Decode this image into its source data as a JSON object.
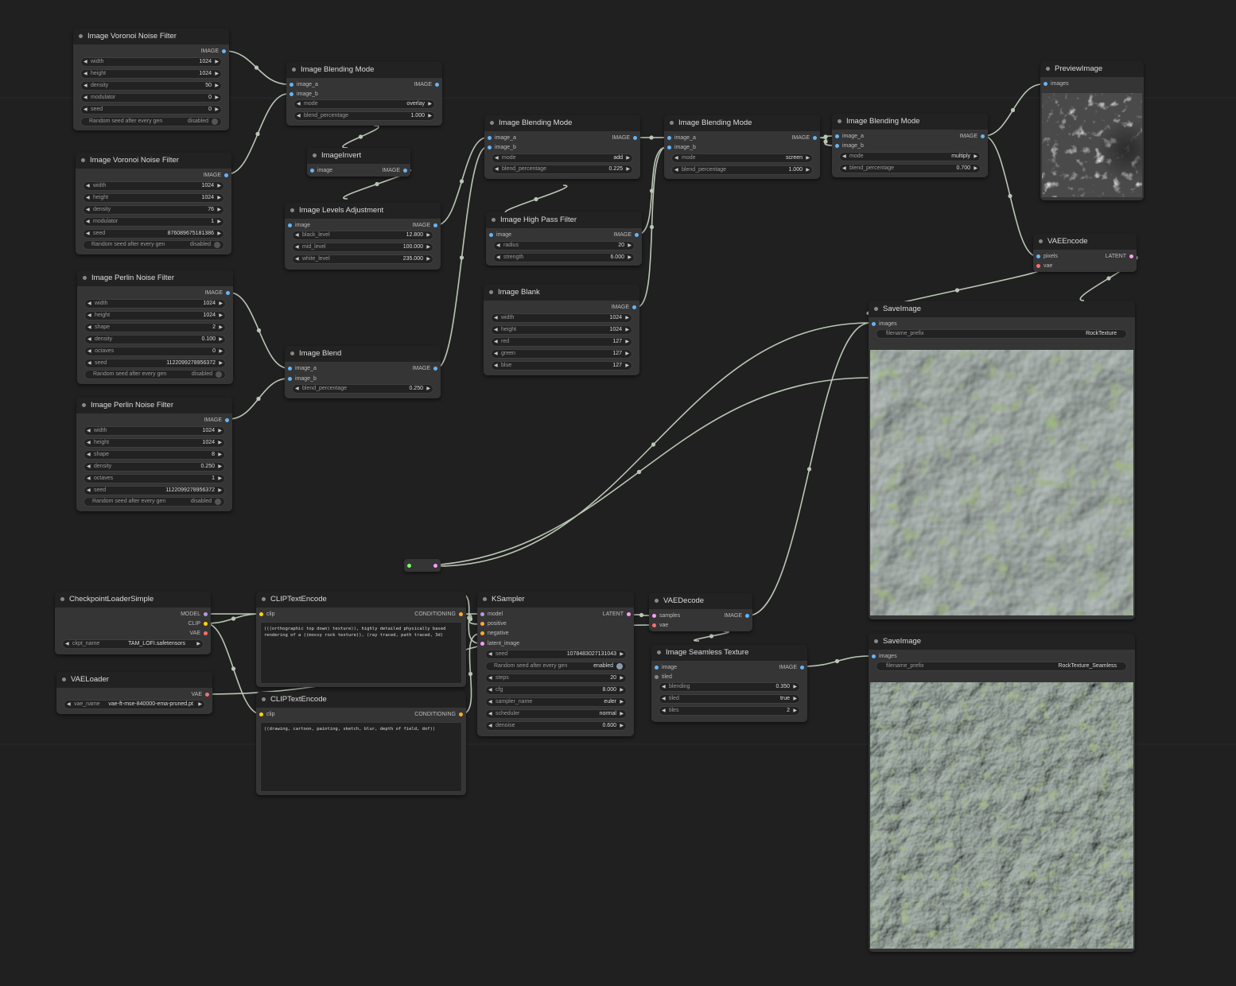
{
  "colors": {
    "canvas": "#202020",
    "node_body": "#353535",
    "node_title": "#222222",
    "wire": "#b9c7b4",
    "image_port": "#64b5f6",
    "latent_port": "#ff9cf9",
    "model_port": "#b39ddb",
    "clip_port": "#ffd500",
    "vae_port": "#ff6e6e",
    "conditioning_port": "#ffa931"
  },
  "nodes": {
    "voronoi1": {
      "title": "Image Voronoi Noise Filter",
      "out": "IMAGE",
      "widgets": [
        {
          "label": "width",
          "value": "1024"
        },
        {
          "label": "height",
          "value": "1024"
        },
        {
          "label": "density",
          "value": "50"
        },
        {
          "label": "modulator",
          "value": "0"
        },
        {
          "label": "seed",
          "value": "0"
        }
      ],
      "toggle": {
        "label": "Random seed after every gen",
        "value": "disabled"
      }
    },
    "voronoi2": {
      "title": "Image Voronoi Noise Filter",
      "out": "IMAGE",
      "widgets": [
        {
          "label": "width",
          "value": "1024"
        },
        {
          "label": "height",
          "value": "1024"
        },
        {
          "label": "density",
          "value": "76"
        },
        {
          "label": "modulator",
          "value": "1"
        },
        {
          "label": "seed",
          "value": "876089675181386"
        }
      ],
      "toggle": {
        "label": "Random seed after every gen",
        "value": "disabled"
      }
    },
    "perlin1": {
      "title": "Image Perlin Noise Filter",
      "out": "IMAGE",
      "widgets": [
        {
          "label": "width",
          "value": "1024"
        },
        {
          "label": "height",
          "value": "1024"
        },
        {
          "label": "shape",
          "value": "2"
        },
        {
          "label": "density",
          "value": "0.100"
        },
        {
          "label": "octaves",
          "value": "0"
        },
        {
          "label": "seed",
          "value": "1122099278956372"
        }
      ],
      "toggle": {
        "label": "Random seed after every gen",
        "value": "disabled"
      }
    },
    "perlin2": {
      "title": "Image Perlin Noise Filter",
      "out": "IMAGE",
      "widgets": [
        {
          "label": "width",
          "value": "1024"
        },
        {
          "label": "height",
          "value": "1024"
        },
        {
          "label": "shape",
          "value": "8"
        },
        {
          "label": "density",
          "value": "0.250"
        },
        {
          "label": "octaves",
          "value": "1"
        },
        {
          "label": "seed",
          "value": "1122099278956372"
        }
      ],
      "toggle": {
        "label": "Random seed after every gen",
        "value": "disabled"
      }
    },
    "blendmode1": {
      "title": "Image Blending Mode",
      "in_a": "image_a",
      "in_b": "image_b",
      "out": "IMAGE",
      "widgets": [
        {
          "label": "mode",
          "value": "overlay"
        },
        {
          "label": "blend_percentage",
          "value": "1.000"
        }
      ]
    },
    "invert": {
      "title": "ImageInvert",
      "in": "image",
      "out": "IMAGE"
    },
    "levels": {
      "title": "Image Levels Adjustment",
      "in": "image",
      "out": "IMAGE",
      "widgets": [
        {
          "label": "black_level",
          "value": "12.800"
        },
        {
          "label": "mid_level",
          "value": "100.000"
        },
        {
          "label": "white_level",
          "value": "235.000"
        }
      ]
    },
    "blend": {
      "title": "Image Blend",
      "in_a": "image_a",
      "in_b": "image_b",
      "out": "IMAGE",
      "widgets": [
        {
          "label": "blend_percentage",
          "value": "0.250"
        }
      ]
    },
    "blendmode2": {
      "title": "Image Blending Mode",
      "in_a": "image_a",
      "in_b": "image_b",
      "out": "IMAGE",
      "widgets": [
        {
          "label": "mode",
          "value": "add"
        },
        {
          "label": "blend_percentage",
          "value": "0.225"
        }
      ]
    },
    "highpass": {
      "title": "Image High Pass Filter",
      "in": "image",
      "out": "IMAGE",
      "widgets": [
        {
          "label": "radius",
          "value": "20"
        },
        {
          "label": "strength",
          "value": "6.000"
        }
      ]
    },
    "blank": {
      "title": "Image Blank",
      "out": "IMAGE",
      "widgets": [
        {
          "label": "width",
          "value": "1024"
        },
        {
          "label": "height",
          "value": "1024"
        },
        {
          "label": "red",
          "value": "127"
        },
        {
          "label": "green",
          "value": "127"
        },
        {
          "label": "blue",
          "value": "127"
        }
      ]
    },
    "blendmode3": {
      "title": "Image Blending Mode",
      "in_a": "image_a",
      "in_b": "image_b",
      "out": "IMAGE",
      "widgets": [
        {
          "label": "mode",
          "value": "screen"
        },
        {
          "label": "blend_percentage",
          "value": "1.000"
        }
      ]
    },
    "blendmode4": {
      "title": "Image Blending Mode",
      "in_a": "image_a",
      "in_b": "image_b",
      "out": "IMAGE",
      "widgets": [
        {
          "label": "mode",
          "value": "multiply"
        },
        {
          "label": "blend_percentage",
          "value": "0.700"
        }
      ]
    },
    "preview": {
      "title": "PreviewImage",
      "in": "images"
    },
    "vaeencode": {
      "title": "VAEEncode",
      "in_a": "pixels",
      "in_b": "vae",
      "out": "LATENT"
    },
    "save1": {
      "title": "SaveImage",
      "in": "images",
      "widget": {
        "label": "filename_prefix",
        "value": "RockTexture"
      }
    },
    "save2": {
      "title": "SaveImage",
      "in": "images",
      "widget": {
        "label": "filename_prefix",
        "value": "RockTexture_Seamless"
      }
    },
    "ckpt": {
      "title": "CheckpointLoaderSimple",
      "out_model": "MODEL",
      "out_clip": "CLIP",
      "out_vae": "VAE",
      "widget": {
        "label": "ckpt_name",
        "value": "TAM_LOFI.safetensors"
      }
    },
    "vaeloader": {
      "title": "VAELoader",
      "out": "VAE",
      "widget": {
        "label": "vae_name",
        "value": "vae-ft-mse-840000-ema-pruned.pt"
      }
    },
    "clip1": {
      "title": "CLIPTextEncode",
      "in": "clip",
      "out": "CONDITIONING",
      "text": "(((orthographic top down) texture)), highly detailed physically based rendering of a ((mossy rock texture)), (ray traced, path traced, 3d)"
    },
    "clip2": {
      "title": "CLIPTextEncode",
      "in": "clip",
      "out": "CONDITIONING",
      "text": "((drawing, cartoon, painting, sketch, blur, depth of field, dof))"
    },
    "ksampler": {
      "title": "KSampler",
      "in_model": "model",
      "in_pos": "positive",
      "in_neg": "negative",
      "in_latent": "latent_image",
      "out": "LATENT",
      "seed": {
        "label": "seed",
        "value": "1078483027131043"
      },
      "toggle": {
        "label": "Random seed after every gen",
        "value": "enabled"
      },
      "widgets": [
        {
          "label": "steps",
          "value": "20"
        },
        {
          "label": "cfg",
          "value": "8.000"
        },
        {
          "label": "sampler_name",
          "value": "euler"
        },
        {
          "label": "scheduler",
          "value": "normal"
        },
        {
          "label": "denoise",
          "value": "0.600"
        }
      ]
    },
    "vaedecode": {
      "title": "VAEDecode",
      "in_a": "samples",
      "in_b": "vae",
      "out": "IMAGE"
    },
    "seamless": {
      "title": "Image Seamless Texture",
      "in_a": "image",
      "in_b": "tiled",
      "out": "IMAGE",
      "widgets": [
        {
          "label": "blending",
          "value": "0.350"
        },
        {
          "label": "tiled",
          "value": "true"
        },
        {
          "label": "tiles",
          "value": "2"
        }
      ]
    }
  }
}
